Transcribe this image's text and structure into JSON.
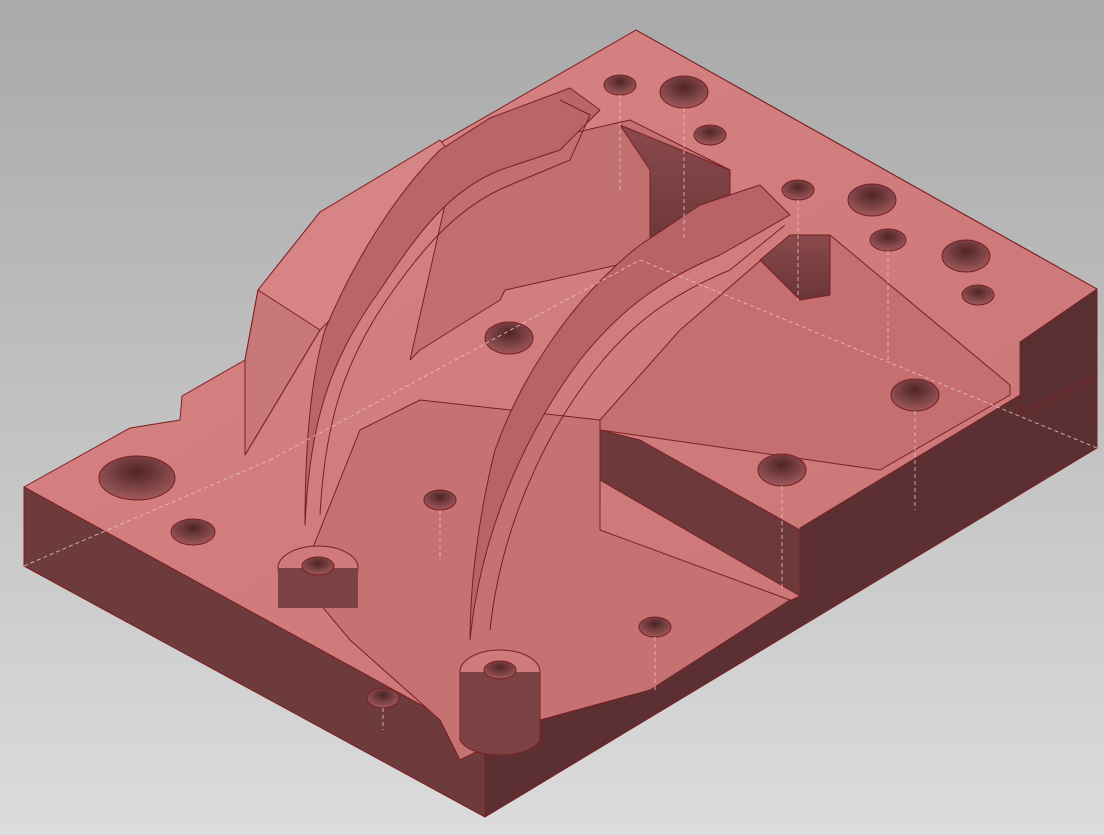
{
  "viewport": {
    "background_top": "#a9a9a9",
    "background_bottom": "#dcdcdc"
  },
  "model": {
    "type": "3D CAD solid (machined mold plate), shaded with edges, isometric view",
    "colors": {
      "top_face": "#cf7b7b",
      "side_face_front": "#6e3b3d",
      "side_face_right": "#5c3032",
      "pocket_floor": "#c67272",
      "pocket_wall": "#7a4244",
      "channel": "#b56466",
      "hole": "#6b3436",
      "edge": "#7a1f24",
      "hidden_edge": "#e7c2c2"
    }
  }
}
